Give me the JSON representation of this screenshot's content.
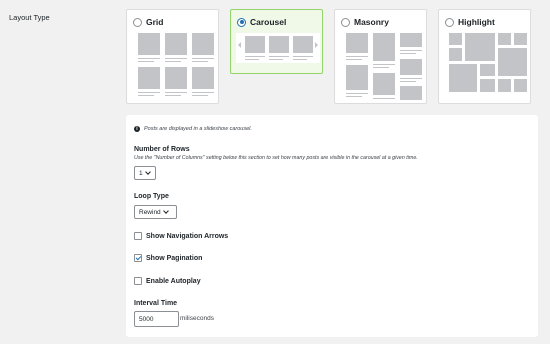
{
  "section_label": "Layout Type",
  "layouts": [
    {
      "label": "Grid",
      "selected": false
    },
    {
      "label": "Carousel",
      "selected": true
    },
    {
      "label": "Masonry",
      "selected": false
    },
    {
      "label": "Highlight",
      "selected": false
    }
  ],
  "panel": {
    "info": "Posts are displayed in a slideshow carousel.",
    "rows": {
      "label": "Number of Rows",
      "description": "Use the \"Number of Columns\" setting below this section to set how many posts are visible in the carousel at a given time.",
      "value": "1"
    },
    "loop": {
      "label": "Loop Type",
      "value": "Rewind"
    },
    "checkboxes": [
      {
        "label": "Show Navigation Arrows",
        "checked": false
      },
      {
        "label": "Show Pagination",
        "checked": true
      },
      {
        "label": "Enable Autoplay",
        "checked": false
      }
    ],
    "interval": {
      "label": "Interval Time",
      "value": "5000",
      "unit": "miliseconds"
    }
  }
}
